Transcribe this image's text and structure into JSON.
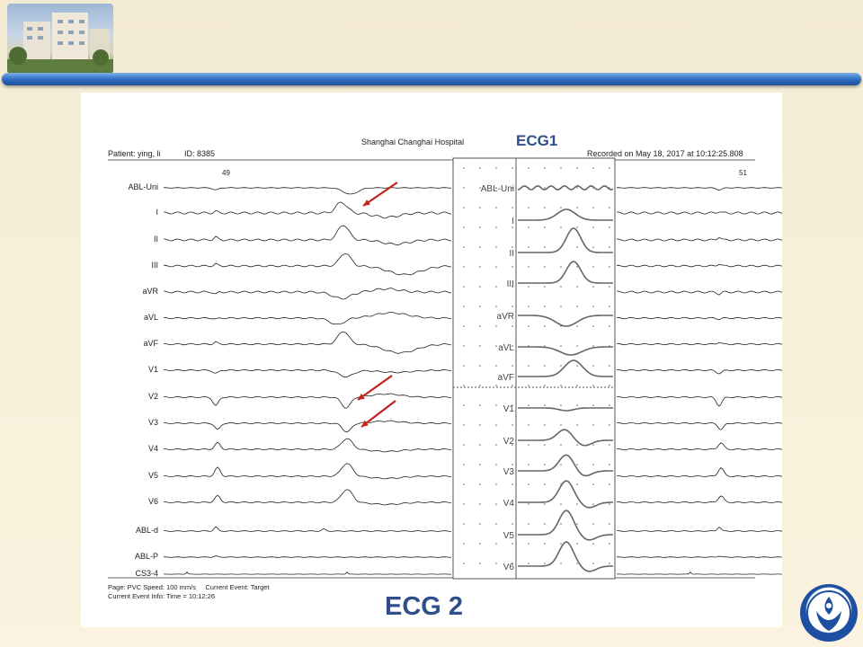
{
  "panel": {
    "patient_text": "Patient: ying, li",
    "id_text": "ID: 8385",
    "hospital": "Shanghai Changhai Hospital",
    "recorded": "Recorded on May 18, 2017 at 10:12:25.808",
    "beat_left": "49",
    "beat_right": "51",
    "ecg1_title": "ECG1",
    "ecg2_title": "ECG 2"
  },
  "leads": [
    "ABL-Uni",
    "I",
    "II",
    "III",
    "aVR",
    "aVL",
    "aVF",
    "V1",
    "V2",
    "V3",
    "V4",
    "V5",
    "V6",
    "ABL-d",
    "ABL-P",
    "CS3-4"
  ],
  "inset_leads": [
    "ABL-Uni",
    "I",
    "II",
    "III",
    "aVR",
    "aVL",
    "aVF",
    "V1",
    "V2",
    "V3",
    "V4",
    "V5",
    "V6"
  ],
  "footer": {
    "line1a": "Page: PVC   Speed: 100 mm/s",
    "line1b": "Current Event: Target",
    "line2": "Current Event Info: Time = 10:12:26"
  },
  "colors": {
    "header_bar": "#2f6fc4",
    "arrow": "#c0221e",
    "title": "#2f4f8a"
  },
  "icons": {
    "arrows": "red-arrow-icon",
    "logo": "hospital-logo-icon"
  }
}
